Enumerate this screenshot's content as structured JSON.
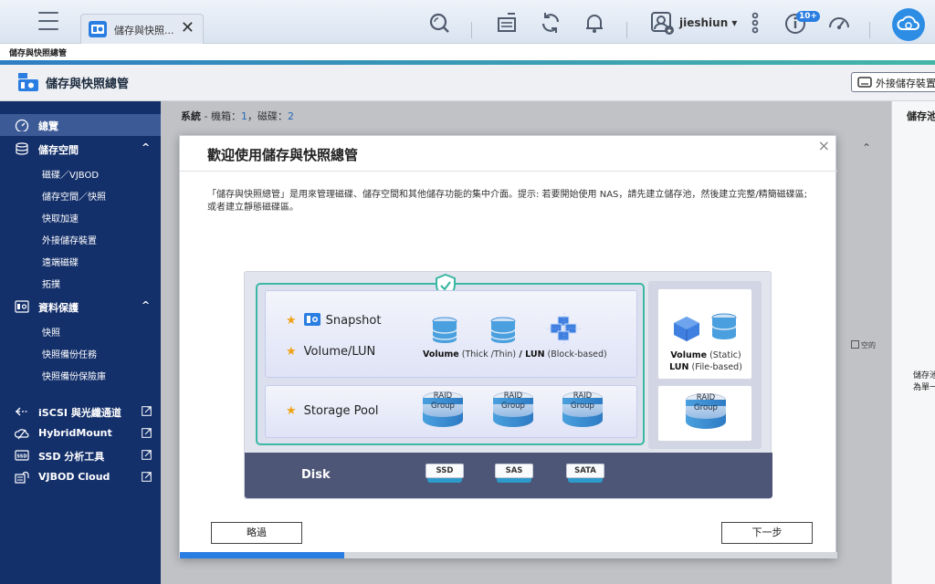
{
  "topbar": {
    "tab_label": "儲存與快照...",
    "tab_close": "✕",
    "user_name": "jieshiun ▾",
    "notification_badge": "10+"
  },
  "breadcrumb": "儲存與快照總管",
  "app": {
    "title": "儲存與快照總管",
    "external_device_button": "外接儲存裝置"
  },
  "sidebar": {
    "items": [
      {
        "label": "總覽",
        "type": "main",
        "active": true
      },
      {
        "label": "儲存空間",
        "type": "main",
        "chevron": "^"
      },
      {
        "label": "磁碟／VJBOD",
        "type": "sub"
      },
      {
        "label": "儲存空間／快照",
        "type": "sub"
      },
      {
        "label": "快取加速",
        "type": "sub"
      },
      {
        "label": "外接儲存裝置",
        "type": "sub"
      },
      {
        "label": "遠端磁碟",
        "type": "sub"
      },
      {
        "label": "拓撲",
        "type": "sub"
      },
      {
        "label": "資料保護",
        "type": "main",
        "chevron": "^"
      },
      {
        "label": "快照",
        "type": "sub"
      },
      {
        "label": "快照備份任務",
        "type": "sub"
      },
      {
        "label": "快照備份保險庫",
        "type": "sub"
      },
      {
        "label": "iSCSI 與光纖通道",
        "type": "main",
        "external": true
      },
      {
        "label": "HybridMount",
        "type": "main",
        "external": true
      },
      {
        "label": "SSD 分析工具",
        "type": "main",
        "external": true
      },
      {
        "label": "VJBOD Cloud",
        "type": "main",
        "external": true
      }
    ]
  },
  "system": {
    "label": "系統",
    "enclosure_label": " - 機箱：",
    "enclosure_count": "1",
    "disk_label": "，磁碟：",
    "disk_count": "2"
  },
  "right_pane": {
    "title": "儲存池",
    "text_line1": "儲存池",
    "text_line2": "為單一",
    "empty_legend": "空的"
  },
  "modal": {
    "title": "歡迎使用儲存與快照總管",
    "close": "×",
    "description": "「儲存與快照總管」是用來管理磁碟、儲存空間和其他儲存功能的集中介面。提示: 若要開始使用 NAS，請先建立儲存池，然後建立完整/精簡磁碟區; 或者建立靜態磁碟區。",
    "diagram": {
      "snapshot": "Snapshot",
      "volume_lun": "Volume/LUN",
      "storage_pool": "Storage Pool",
      "volume_label": "Volume",
      "volume_detail": " (Thick /Thin)",
      "lun_label": " / LUN",
      "lun_detail": " (Block-based)",
      "raid_line1": "RAID",
      "raid_line2": "Group",
      "static_volume_label": "Volume",
      "static_volume_detail": " (Static)",
      "static_lun_label": "LUN",
      "static_lun_detail": " (File-based)",
      "disk": "Disk",
      "drives": [
        "SSD",
        "SAS",
        "SATA"
      ]
    },
    "skip_button": "略過",
    "next_button": "下一步",
    "progress": 0.25
  },
  "colors": {
    "sidebar_bg": "#14306b",
    "accent": "#2a7de1",
    "teal_frame": "#3ab8a4",
    "disk_bar": "#4d5677",
    "star": "#f0a217"
  }
}
